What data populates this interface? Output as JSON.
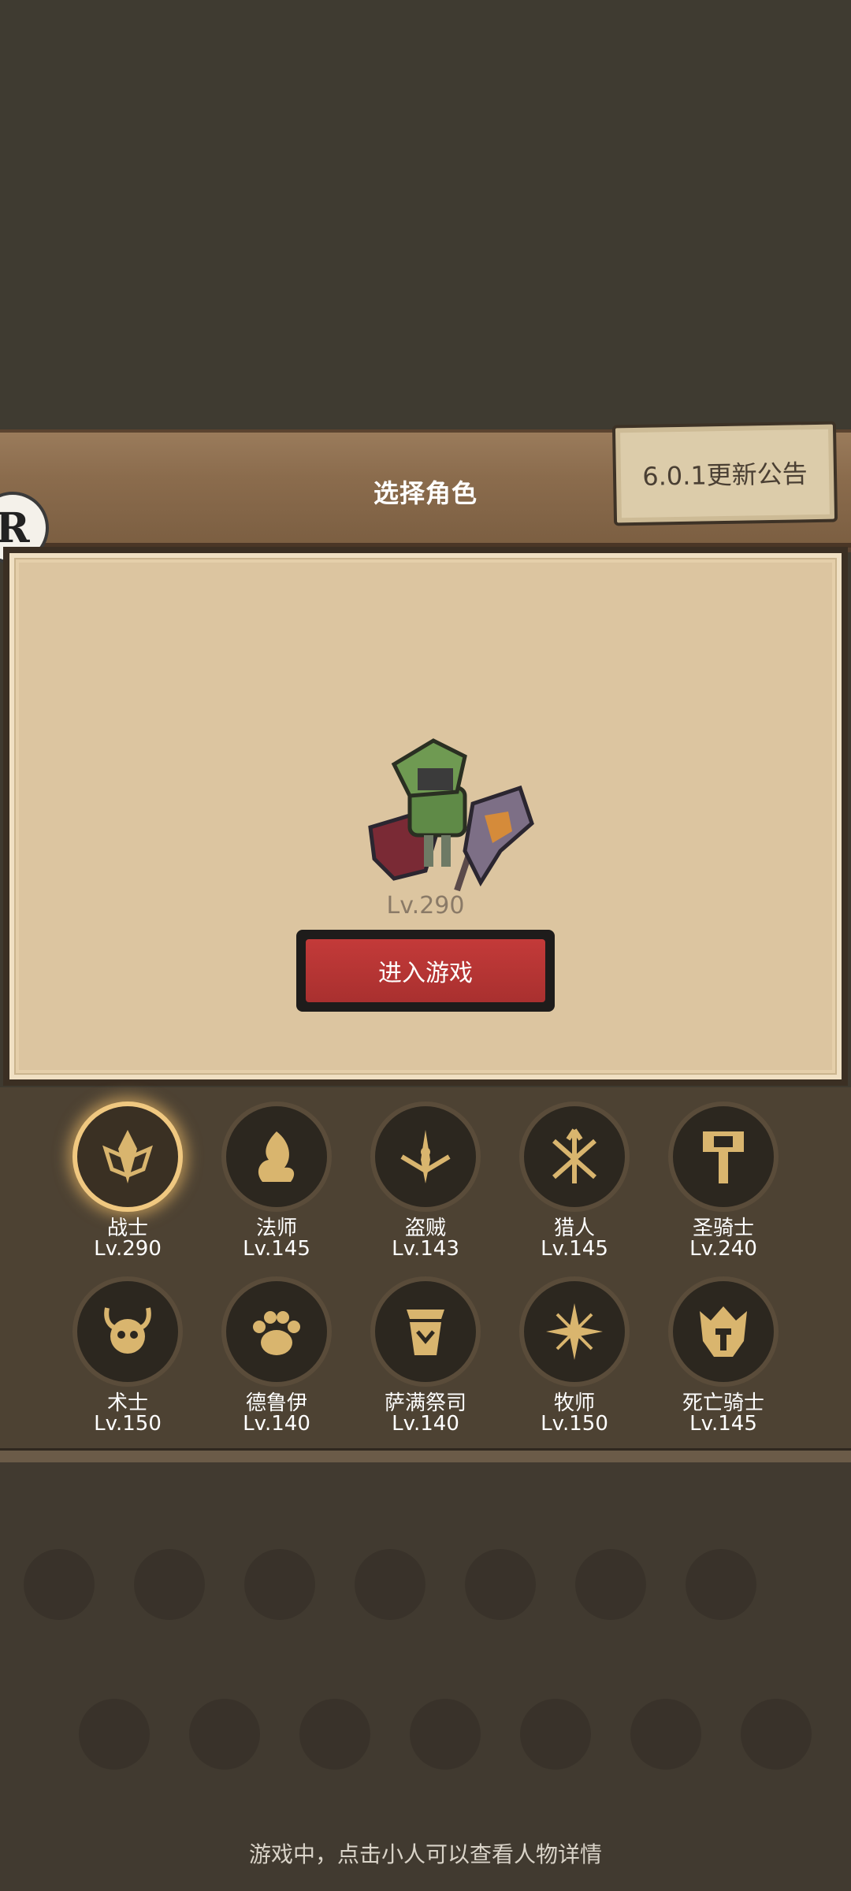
{
  "header": {
    "title": "选择角色"
  },
  "notice": {
    "label": "6.0.1更新公告"
  },
  "badge": {
    "letter": "R"
  },
  "selected_character": {
    "level": "Lv.290"
  },
  "enter_button": {
    "label": "进入游戏"
  },
  "classes": [
    {
      "name": "战士",
      "level": "Lv.290",
      "icon": "sword-shield-icon",
      "selected": true
    },
    {
      "name": "法师",
      "level": "Lv.145",
      "icon": "flame-icon"
    },
    {
      "name": "盗贼",
      "level": "Lv.143",
      "icon": "daggers-icon"
    },
    {
      "name": "猎人",
      "level": "Lv.145",
      "icon": "arrows-icon"
    },
    {
      "name": "圣骑士",
      "level": "Lv.240",
      "icon": "hammer-icon"
    },
    {
      "name": "术士",
      "level": "Lv.150",
      "icon": "skull-horns-icon"
    },
    {
      "name": "德鲁伊",
      "level": "Lv.140",
      "icon": "paw-icon"
    },
    {
      "name": "萨满祭司",
      "level": "Lv.140",
      "icon": "totem-icon"
    },
    {
      "name": "牧师",
      "level": "Lv.150",
      "icon": "star-burst-icon"
    },
    {
      "name": "死亡骑士",
      "level": "Lv.145",
      "icon": "death-helm-icon"
    }
  ],
  "footer": {
    "hint": "游戏中，点击小人可以查看人物详情"
  },
  "colors": {
    "accent_gold": "#d9b56e",
    "button_red": "#c33a39"
  }
}
